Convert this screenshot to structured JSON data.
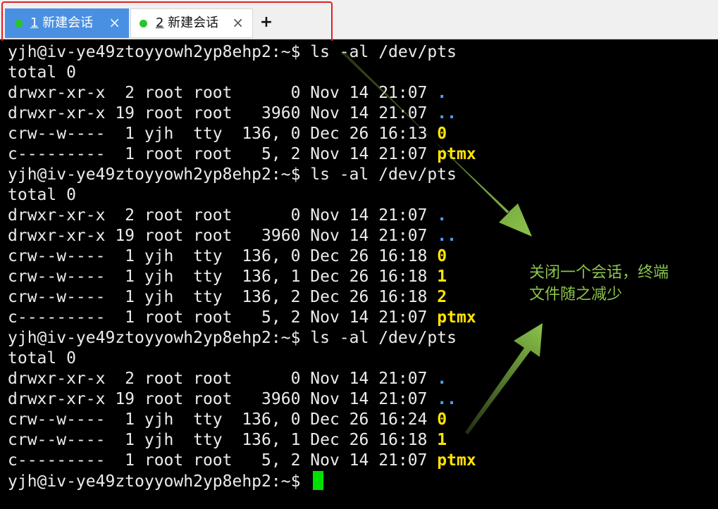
{
  "tabs": [
    {
      "number": "1",
      "name": " 新建会话",
      "close": "×",
      "active": true
    },
    {
      "number": "2",
      "name": " 新建会话",
      "close": "×",
      "active": false
    }
  ],
  "add_tab": "+",
  "terminal": {
    "lines": [
      {
        "text": "yjh@iv-ye49ztoyyowh2yp8ehp2:~$ ls -al /dev/pts"
      },
      {
        "text": "total 0"
      },
      {
        "text": "drwxr-xr-x  2 root root      0 Nov 14 21:07 ",
        "name": "."
      },
      {
        "text": "drwxr-xr-x 19 root root   3960 Nov 14 21:07 ",
        "name": ".."
      },
      {
        "text": "crw--w----  1 yjh  tty  136, 0 Dec 26 16:13 ",
        "name": "0"
      },
      {
        "text": "c---------  1 root root   5, 2 Nov 14 21:07 ",
        "name": "ptmx"
      },
      {
        "text": "yjh@iv-ye49ztoyyowh2yp8ehp2:~$ ls -al /dev/pts"
      },
      {
        "text": "total 0"
      },
      {
        "text": "drwxr-xr-x  2 root root      0 Nov 14 21:07 ",
        "name": "."
      },
      {
        "text": "drwxr-xr-x 19 root root   3960 Nov 14 21:07 ",
        "name": ".."
      },
      {
        "text": "crw--w----  1 yjh  tty  136, 0 Dec 26 16:18 ",
        "name": "0"
      },
      {
        "text": "crw--w----  1 yjh  tty  136, 1 Dec 26 16:18 ",
        "name": "1"
      },
      {
        "text": "crw--w----  1 yjh  tty  136, 2 Dec 26 16:18 ",
        "name": "2"
      },
      {
        "text": "c---------  1 root root   5, 2 Nov 14 21:07 ",
        "name": "ptmx"
      },
      {
        "text": "yjh@iv-ye49ztoyyowh2yp8ehp2:~$ ls -al /dev/pts"
      },
      {
        "text": "total 0"
      },
      {
        "text": "drwxr-xr-x  2 root root      0 Nov 14 21:07 ",
        "name": "."
      },
      {
        "text": "drwxr-xr-x 19 root root   3960 Nov 14 21:07 ",
        "name": ".."
      },
      {
        "text": "crw--w----  1 yjh  tty  136, 0 Dec 26 16:24 ",
        "name": "0"
      },
      {
        "text": "crw--w----  1 yjh  tty  136, 1 Dec 26 16:18 ",
        "name": "1"
      },
      {
        "text": "c---------  1 root root   5, 2 Nov 14 21:07 ",
        "name": "ptmx"
      },
      {
        "text": "yjh@iv-ye49ztoyyowh2yp8ehp2:~$ "
      }
    ]
  },
  "annotation": {
    "line1": "关闭一个会话，终端",
    "line2": "文件随之减少"
  },
  "colors": {
    "tab_active": "#4a90e2",
    "session_dot": "#28c628",
    "highlight": "#e02020",
    "directory": "#4aa3ff",
    "device": "#ffe400",
    "cursor": "#00e000",
    "annotation": "#8bc34a"
  }
}
